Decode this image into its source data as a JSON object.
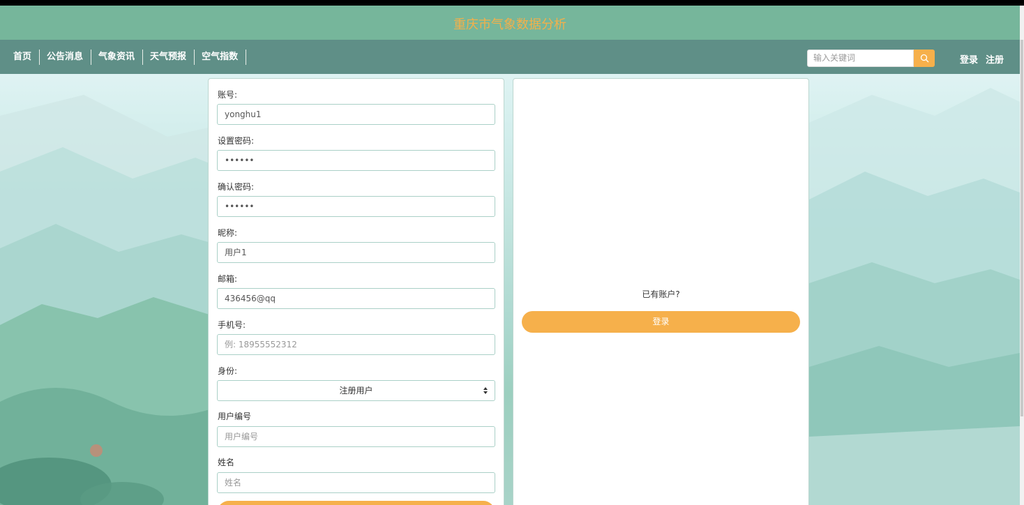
{
  "header": {
    "site_title": "重庆市气象数据分析",
    "title_color": "#f3b04a",
    "bar_color": "#76b69b"
  },
  "nav": {
    "items": [
      {
        "label": "首页"
      },
      {
        "label": "公告消息"
      },
      {
        "label": "气象资讯"
      },
      {
        "label": "天气预报"
      },
      {
        "label": "空气指数"
      }
    ],
    "search": {
      "placeholder": "输入关键词",
      "icon": "search-icon"
    },
    "login_label": "登录",
    "register_label": "注册",
    "bar_color": "#5f8f87"
  },
  "form": {
    "account": {
      "label": "账号:",
      "value": "yonghu1"
    },
    "password": {
      "label": "设置密码:",
      "value": "••••••"
    },
    "confirm_password": {
      "label": "确认密码:",
      "value": "••••••"
    },
    "nickname": {
      "label": "昵称:",
      "value": "用户1"
    },
    "email": {
      "label": "邮箱:",
      "value": "436456@qq"
    },
    "phone": {
      "label": "手机号:",
      "placeholder": "例: 18955552312"
    },
    "identity": {
      "label": "身份:",
      "selected": "注册用户"
    },
    "user_id": {
      "label": "用户编号",
      "placeholder": "用户编号"
    },
    "name": {
      "label": "姓名",
      "placeholder": "姓名"
    }
  },
  "side": {
    "have_account_text": "已有账户?",
    "login_button": "登录"
  },
  "colors": {
    "accent": "#f6b04b",
    "input_border": "#aad0c7"
  }
}
